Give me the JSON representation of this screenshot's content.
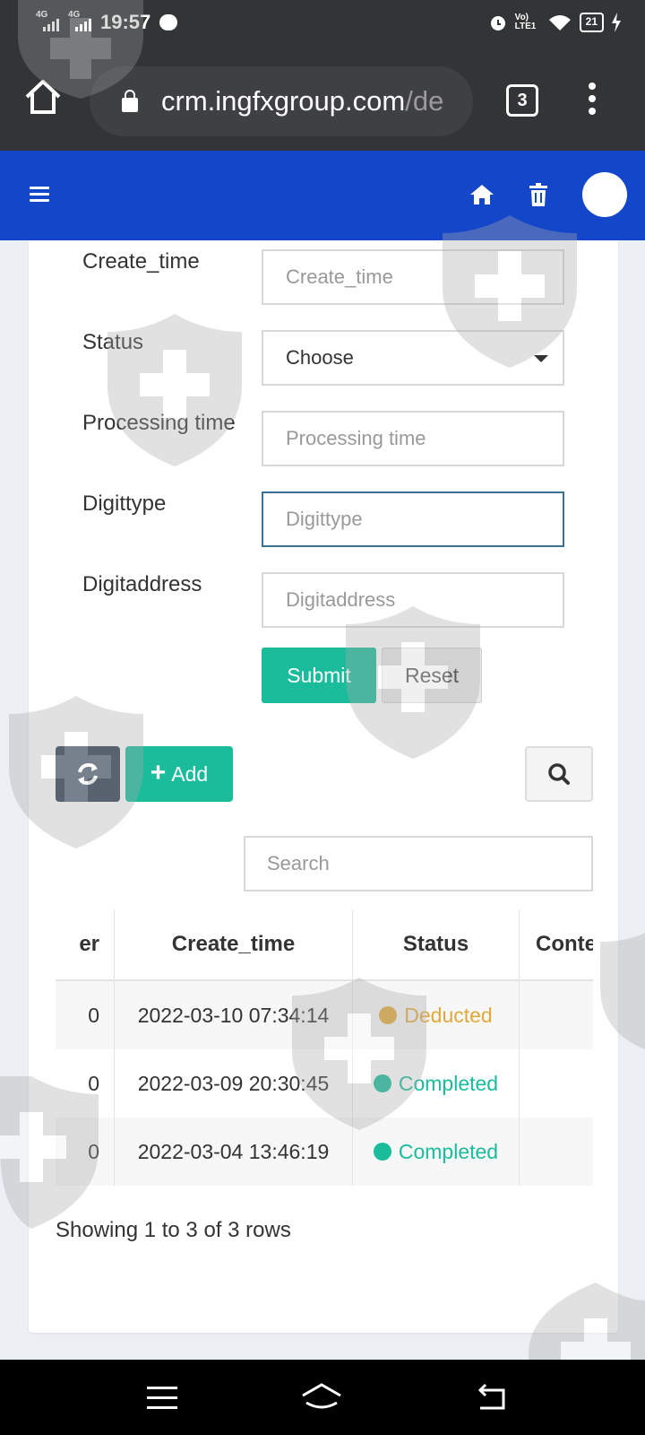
{
  "status_bar": {
    "net1": "4G",
    "net2": "4G",
    "time": "19:57",
    "carrier_badge": "Vo) LTE1",
    "battery": "21"
  },
  "browser": {
    "url_host": "crm.ingfxgroup.com",
    "url_path": "/de",
    "tab_count": "3"
  },
  "form": {
    "fields": [
      {
        "label": "Create_time",
        "placeholder": "Create_time"
      },
      {
        "label": "Status",
        "value": "Choose"
      },
      {
        "label": "Processing time",
        "placeholder": "Processing time"
      },
      {
        "label": "Digittype",
        "placeholder": "Digittype"
      },
      {
        "label": "Digitaddress",
        "placeholder": "Digitaddress"
      }
    ],
    "submit_label": "Submit",
    "reset_label": "Reset"
  },
  "toolbar": {
    "add_label": "Add",
    "search_placeholder": "Search"
  },
  "table": {
    "headers": [
      "er",
      "Create_time",
      "Status",
      "Conten"
    ],
    "rows": [
      {
        "c0": "0",
        "create_time": "2022-03-10 07:34:14",
        "status": "Deducted",
        "status_color": "#e0a93c",
        "content": "-"
      },
      {
        "c0": "0",
        "create_time": "2022-03-09 20:30:45",
        "status": "Completed",
        "status_color": "#1abc9c",
        "content": "-"
      },
      {
        "c0": "0",
        "create_time": "2022-03-04 13:46:19",
        "status": "Completed",
        "status_color": "#1abc9c",
        "content": "-"
      }
    ],
    "footer": "Showing 1 to 3 of 3 rows"
  },
  "colors": {
    "header_blue": "#1346c9",
    "accent_green": "#1abc9c",
    "dark_btn": "#2c3e50",
    "deducted_orange": "#e0a93c"
  }
}
